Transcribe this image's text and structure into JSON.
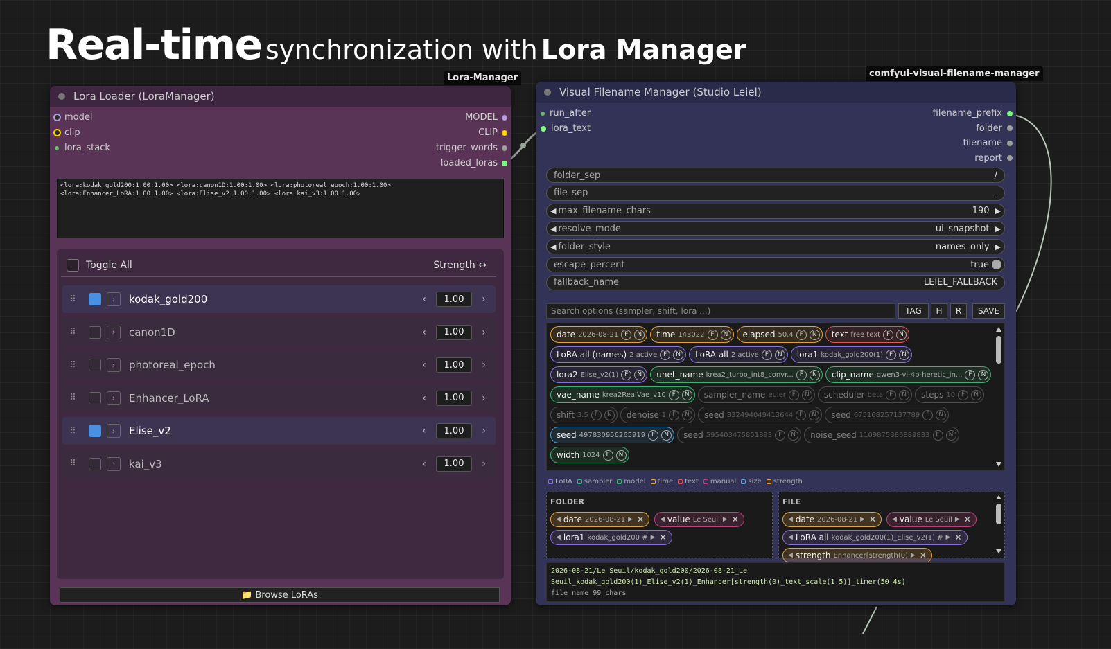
{
  "title": {
    "big": "Real-time",
    "mid1": "synchronization with",
    "bold": "Lora Manager"
  },
  "tags": {
    "left": "Lora-Manager",
    "right": "comfyui-visual-filename-manager"
  },
  "left_node": {
    "title": "Lora Loader (LoraManager)",
    "inputs": [
      {
        "label": "model",
        "color": "#b39ddb"
      },
      {
        "label": "clip",
        "color": "#ffd500"
      },
      {
        "label": "lora_stack",
        "color": "#66bb6a"
      }
    ],
    "outputs": [
      {
        "label": "MODEL",
        "color": "#b39ddb"
      },
      {
        "label": "CLIP",
        "color": "#ffd500"
      },
      {
        "label": "trigger_words",
        "color": "#9e9e9e"
      },
      {
        "label": "loaded_loras",
        "color": "#7cfc7c"
      }
    ],
    "text": "<lora:kodak_gold200:1.00:1.00> <lora:canon1D:1.00:1.00> <lora:photoreal_epoch:1.00:1.00>\n<lora:Enhancer_LoRA:1.00:1.00> <lora:Elise_v2:1.00:1.00> <lora:kai_v3:1.00:1.00>",
    "toggle_all": "Toggle All",
    "strength": "Strength ↔",
    "loras": [
      {
        "name": "kodak_gold200",
        "value": "1.00",
        "enabled": true
      },
      {
        "name": "canon1D",
        "value": "1.00",
        "enabled": false
      },
      {
        "name": "photoreal_epoch",
        "value": "1.00",
        "enabled": false
      },
      {
        "name": "Enhancer_LoRA",
        "value": "1.00",
        "enabled": false
      },
      {
        "name": "Elise_v2",
        "value": "1.00",
        "enabled": true
      },
      {
        "name": "kai_v3",
        "value": "1.00",
        "enabled": false
      }
    ],
    "browse": "📁 Browse LoRAs"
  },
  "right_node": {
    "title": "Visual Filename Manager (Studio Leiel)",
    "inputs": [
      {
        "label": "run_after",
        "color": "#66bb6a"
      },
      {
        "label": "lora_text",
        "color": "#7cfc7c"
      }
    ],
    "outputs": [
      {
        "label": "filename_prefix",
        "color": "#7cfc7c"
      },
      {
        "label": "folder",
        "color": "#9e9e9e"
      },
      {
        "label": "filename",
        "color": "#9e9e9e"
      },
      {
        "label": "report",
        "color": "#9e9e9e"
      }
    ],
    "widgets": [
      {
        "label": "folder_sep",
        "value": "/",
        "arrows": false
      },
      {
        "label": "file_sep",
        "value": "_",
        "arrows": false
      },
      {
        "label": "max_filename_chars",
        "value": "190",
        "arrows": true
      },
      {
        "label": "resolve_mode",
        "value": "ui_snapshot",
        "arrows": true
      },
      {
        "label": "folder_style",
        "value": "names_only",
        "arrows": true
      },
      {
        "label": "escape_percent",
        "value": "true",
        "arrows": false
      },
      {
        "label": "fallback_name",
        "value": "LEIEL_FALLBACK",
        "arrows": false
      }
    ],
    "search_placeholder": "Search options (sampler, shift, lora ...)",
    "buttons": [
      "TAG",
      "H",
      "R",
      "SAVE"
    ],
    "chips": [
      {
        "k": "date",
        "s": "2026-08-21",
        "c": "#e6a23c",
        "dim": false
      },
      {
        "k": "time",
        "s": "143022",
        "c": "#e6a23c",
        "dim": false
      },
      {
        "k": "elapsed",
        "s": "50.4",
        "c": "#e6a23c",
        "dim": false
      },
      {
        "k": "text",
        "s": "free text",
        "c": "#e05555",
        "dim": false
      },
      {
        "k": "LoRA all (names)",
        "s": "2 active",
        "c": "#8a6fe0",
        "dim": false
      },
      {
        "k": "LoRA all",
        "s": "2 active",
        "c": "#8a6fe0",
        "dim": false
      },
      {
        "k": "lora1",
        "s": "kodak_gold200(1)",
        "c": "#8a6fe0",
        "dim": false
      },
      {
        "k": "lora2",
        "s": "Elise_v2(1)",
        "c": "#8a6fe0",
        "dim": false
      },
      {
        "k": "unet_name",
        "s": "krea2_turbo_int8_convr...",
        "c": "#3cb371",
        "dim": false
      },
      {
        "k": "clip_name",
        "s": "qwen3-vl-4b-heretic_in...",
        "c": "#3cb371",
        "dim": false
      },
      {
        "k": "vae_name",
        "s": "krea2RealVae_v10",
        "c": "#3cb371",
        "dim": false
      },
      {
        "k": "sampler_name",
        "s": "euler",
        "c": "#888",
        "dim": true
      },
      {
        "k": "scheduler",
        "s": "beta",
        "c": "#888",
        "dim": true
      },
      {
        "k": "steps",
        "s": "10",
        "c": "#888",
        "dim": true
      },
      {
        "k": "shift",
        "s": "3.5",
        "c": "#888",
        "dim": true
      },
      {
        "k": "denoise",
        "s": "1",
        "c": "#888",
        "dim": true
      },
      {
        "k": "seed",
        "s": "332494049413644",
        "c": "#888",
        "dim": true
      },
      {
        "k": "seed",
        "s": "675168257137789",
        "c": "#888",
        "dim": true
      },
      {
        "k": "seed",
        "s": "497830956265919",
        "c": "#4aa3df",
        "dim": false
      },
      {
        "k": "seed",
        "s": "595403475851893",
        "c": "#888",
        "dim": true
      },
      {
        "k": "noise_seed",
        "s": "1109875386889833",
        "c": "#888",
        "dim": true
      },
      {
        "k": "width",
        "s": "1024",
        "c": "#3cb371",
        "dim": false
      }
    ],
    "legend": [
      "LoRA",
      "sampler",
      "model",
      "time",
      "text",
      "manual",
      "size",
      "strength"
    ],
    "legend_colors": [
      "#8a6fe0",
      "#3cb371",
      "#3cb371",
      "#e6a23c",
      "#e05555",
      "#c04080",
      "#4aa3df",
      "#e6a23c"
    ],
    "folder": {
      "label": "FOLDER",
      "chips": [
        {
          "k": "date",
          "s": "2026-08-21",
          "c": "#e6a23c"
        },
        {
          "k": "value",
          "s": "Le Seuil",
          "c": "#c04080"
        },
        {
          "k": "lora1",
          "s": "kodak_gold200 #",
          "c": "#8a6fe0"
        }
      ]
    },
    "file": {
      "label": "FILE",
      "chips": [
        {
          "k": "date",
          "s": "2026-08-21",
          "c": "#e6a23c"
        },
        {
          "k": "value",
          "s": "Le Seuil",
          "c": "#c04080"
        },
        {
          "k": "LoRA all",
          "s": "kodak_gold200(1)_Elise_v2(1) #",
          "c": "#8a6fe0"
        },
        {
          "k": "strength",
          "s": "Enhancer[strength(0)",
          "c": "#e6a23c"
        }
      ]
    },
    "preview": {
      "path": "2026-08-21/Le Seuil/kodak_gold200/2026-08-21_Le Seuil_kodak_gold200(1)_Elise_v2(1)_Enhancer[strength(0)_text_scale(1.5)]_timer(50.4s)",
      "chars": "file name 99 chars"
    }
  }
}
